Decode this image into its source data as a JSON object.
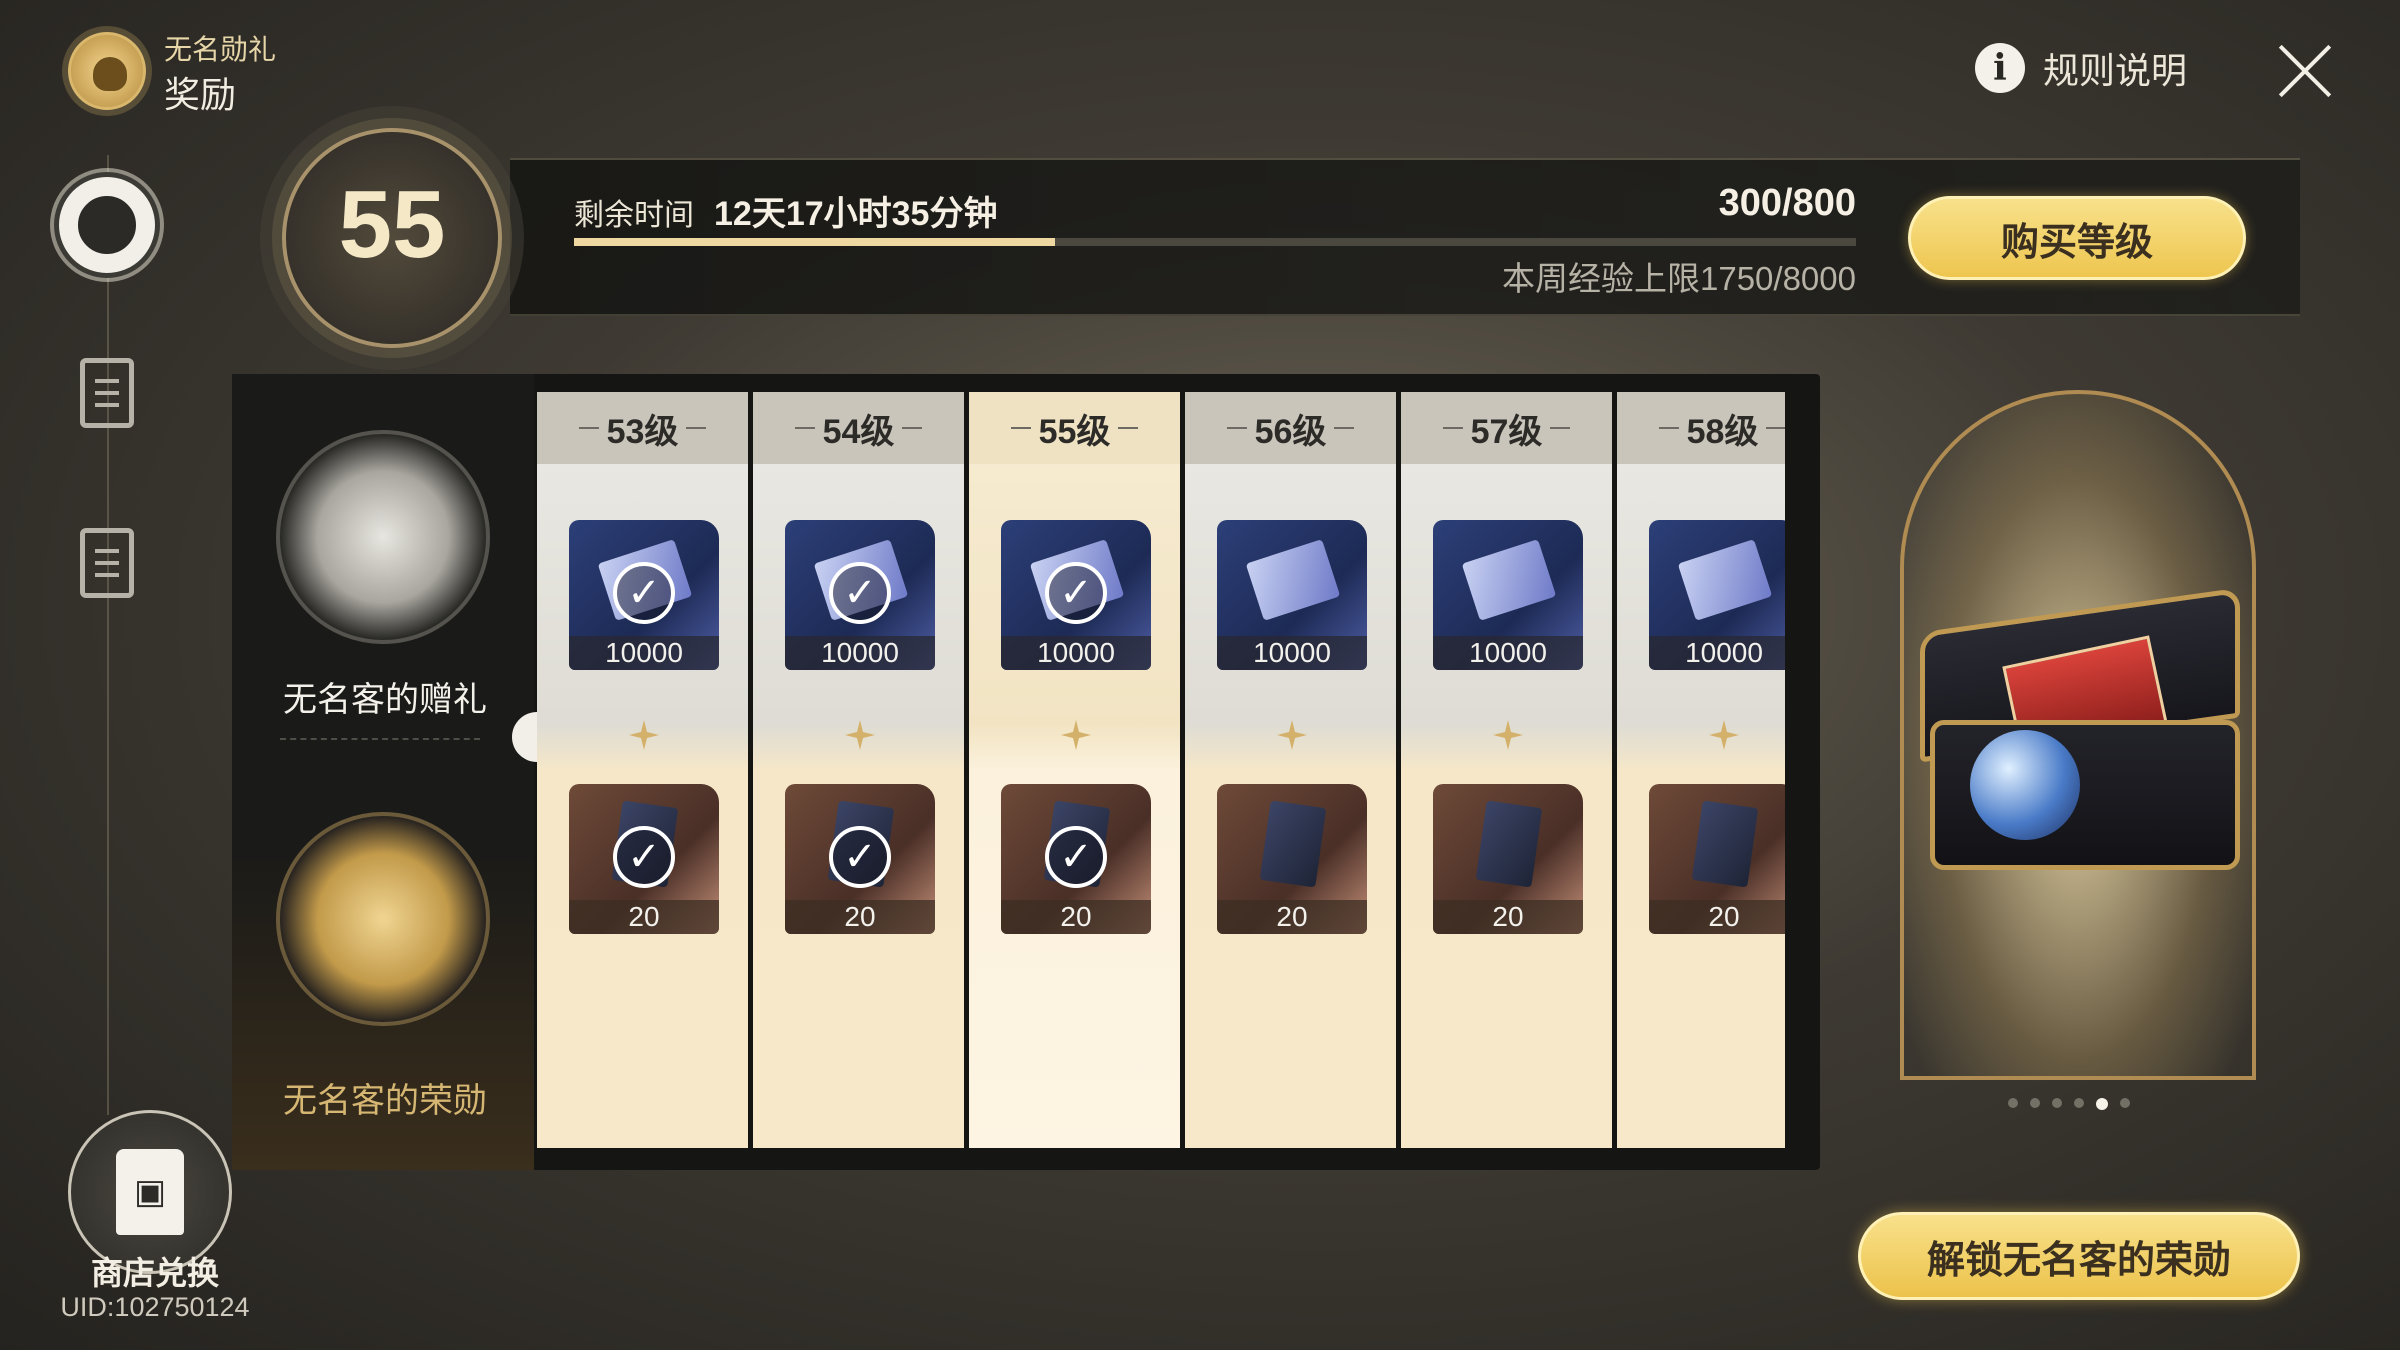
{
  "header": {
    "subtitle": "无名勋礼",
    "title": "奖励"
  },
  "top_right": {
    "rules_label": "规则说明",
    "rules_icon": "info-icon",
    "close_icon": "close-icon"
  },
  "nav": {
    "items": [
      {
        "name": "rewards",
        "icon": "emblem-icon",
        "active": true
      },
      {
        "name": "missions",
        "icon": "clipboard-check-icon",
        "active": false
      },
      {
        "name": "log",
        "icon": "document-search-icon",
        "active": false
      }
    ],
    "shop_label": "商店兑换",
    "shop_icon": "shopping-bag-icon",
    "uid": "UID:102750124"
  },
  "level": {
    "current": "55",
    "time_label": "剩余时间",
    "time_value": "12天17小时35分钟",
    "exp": "300/800",
    "exp_progress": 0.375,
    "weekly_cap": "本周经验上限1750/8000",
    "buy_button": "购买等级"
  },
  "tracks": {
    "free_label": "无名客的赠礼",
    "premium_label": "无名客的荣勋"
  },
  "levels": [
    {
      "label": "53级",
      "free": {
        "qty": "10000",
        "claimed": true
      },
      "premium": {
        "qty": "20",
        "claimed": true
      },
      "current": false
    },
    {
      "label": "54级",
      "free": {
        "qty": "10000",
        "claimed": true
      },
      "premium": {
        "qty": "20",
        "claimed": true
      },
      "current": false
    },
    {
      "label": "55级",
      "free": {
        "qty": "10000",
        "claimed": true
      },
      "premium": {
        "qty": "20",
        "claimed": true
      },
      "current": true
    },
    {
      "label": "56级",
      "free": {
        "qty": "10000",
        "claimed": false
      },
      "premium": {
        "qty": "20",
        "claimed": false
      },
      "current": false
    },
    {
      "label": "57级",
      "free": {
        "qty": "10000",
        "claimed": false
      },
      "premium": {
        "qty": "20",
        "claimed": false
      },
      "current": false
    },
    {
      "label": "58级",
      "free": {
        "qty": "10000",
        "claimed": false
      },
      "premium": {
        "qty": "20",
        "claimed": false
      },
      "current": false
    }
  ],
  "showcase": {
    "carousel_count": 6,
    "carousel_active": 4
  },
  "unlock_button": "解锁无名客的荣勋",
  "colors": {
    "accent_gold": "#eec64f",
    "panel_dark": "#151513",
    "premium_text": "#d5b672"
  }
}
